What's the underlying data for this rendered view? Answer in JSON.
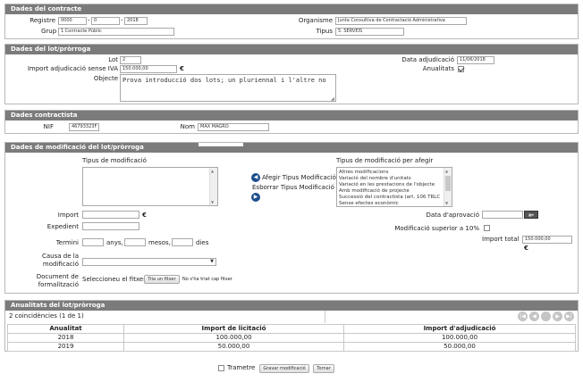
{
  "contracte": {
    "title": "Dades del contracte",
    "registre_label": "Registre",
    "registre_1": "0000",
    "registre_2": "0",
    "registre_3": "2018",
    "organisme_label": "Organisme",
    "organisme_value": "Junta Consultiva de Contractació Administrativa",
    "grup_label": "Grup",
    "grup_value": "1 Contracte Públic",
    "tipus_label": "Tipus",
    "tipus_value": "5. SERVEIS"
  },
  "lot": {
    "title": "Dades del lot/pròrroga",
    "lot_label": "Lot",
    "lot_value": "2",
    "data_adj_label": "Data adjudicació",
    "data_adj_value": "11/06/2018",
    "import_label": "Import adjudicació sense IVA",
    "import_value": "150.000,00",
    "euro": "€",
    "anualitats_label": "Anualitats",
    "anualitats_checked": true,
    "objecte_label": "Objecte",
    "objecte_value": "Prova introducció dos lots; un pluriennal i l'altre no"
  },
  "contractista": {
    "title": "Dades contractista",
    "nif_label": "NIF",
    "nif_value": "46793323F",
    "nom_label": "Nom",
    "nom_value": "MAX MAGRO"
  },
  "modificacio": {
    "title": "Dades de modificació del lot/pròrroga",
    "tipus_label": "Tipus de modificació",
    "tipus_afegir_label": "Tipus de modificació per afegir",
    "afegir_label": "Afegir Tipus Modificació",
    "esborrar_label": "Esborrar Tipus Modificació",
    "afegir_options": [
      "Altres modificacions",
      "Variació del nombre d'unitats",
      "Variació en les prestacions de l'objecte",
      "Amb modificació de projecte",
      "Successió del contractista (art. 106 TRLC",
      "Sense efectes econòmic"
    ],
    "import_label": "Import",
    "euro": "€",
    "expedient_label": "Expedient",
    "termini_label": "Termini",
    "anys": "anys,",
    "mesos": "mesos,",
    "dies": "dies",
    "causa_label_1": "Causa de la",
    "causa_label_2": "modificació",
    "document_label_1": "Document de",
    "document_label_2": "formalització",
    "seleccioneu": "Seleccioneu el fitxer",
    "tria_fitxer": "Tria un fitxer",
    "no_fitxer": "No s'ha triat cap fitxer",
    "data_aprovacio_label": "Data d'aprovació",
    "superior_label": "Modificació superior a 10%",
    "import_total_label": "Import total",
    "import_total_value": "150.000,00"
  },
  "anualitats": {
    "title": "Anualitats del lot/pròrroga",
    "coincidencies": "2 coincidències (1 de 1)",
    "headers": [
      "Anualitat",
      "Import de licitació",
      "Import d'adjudicació"
    ],
    "rows": [
      [
        "2018",
        "100.000,00",
        "100.000,00"
      ],
      [
        "2019",
        "50.000,00",
        "50.000,00"
      ]
    ]
  },
  "footer": {
    "trametre_label": "Trametre",
    "gravar_label": "Gravar modificació",
    "tornar_label": "Tornar"
  }
}
